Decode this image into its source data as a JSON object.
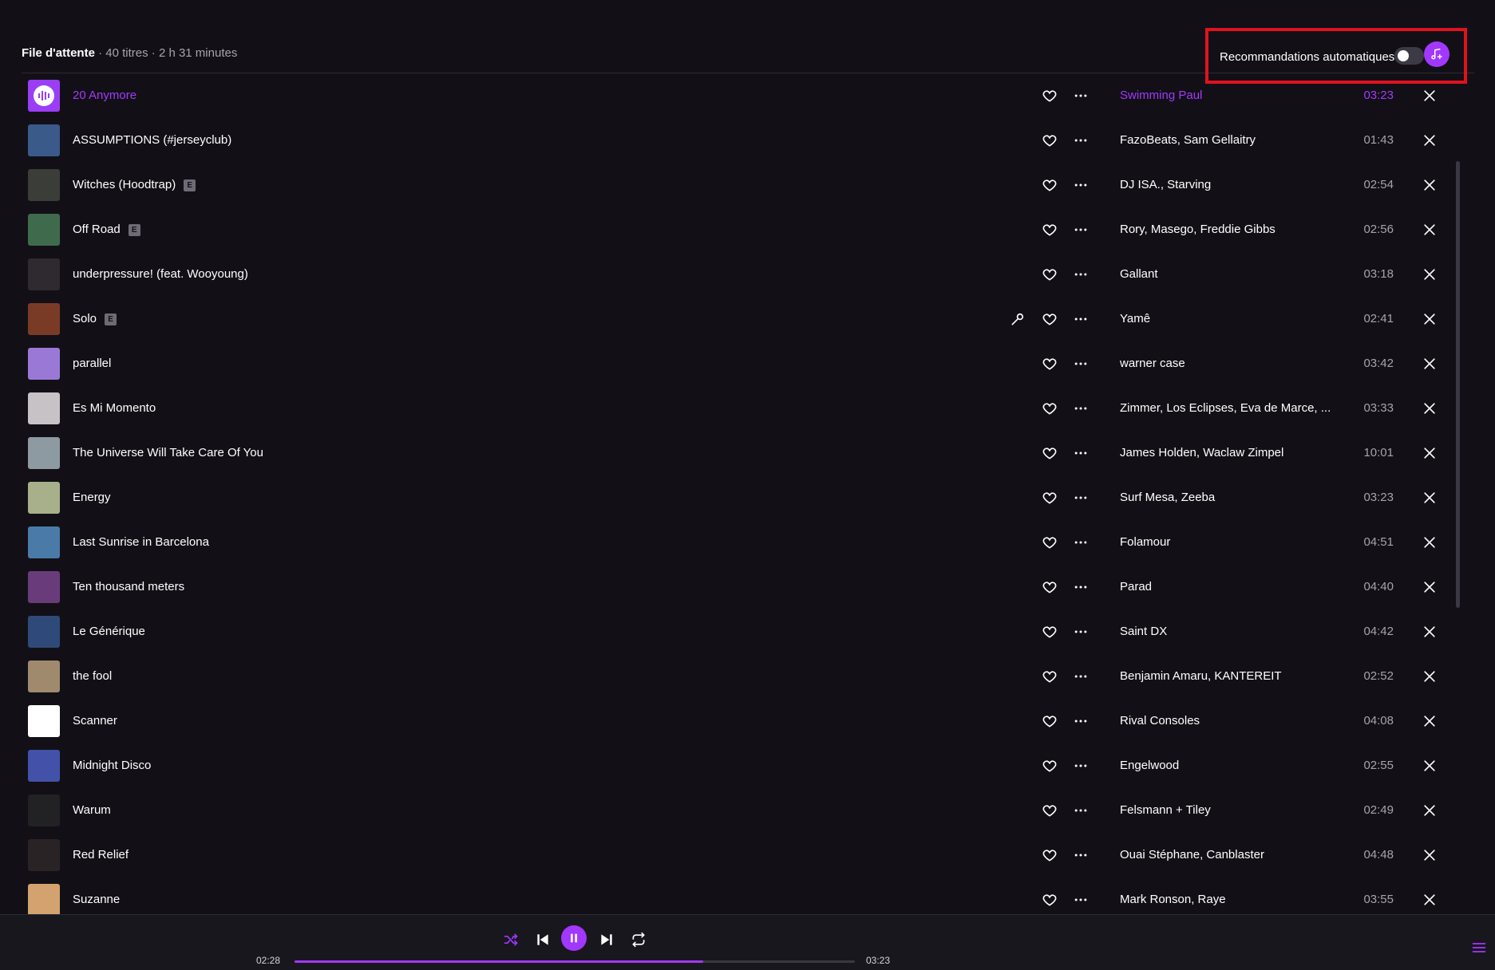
{
  "header": {
    "title": "File d'attente",
    "meta": " · 40 titres · 2 h 31 minutes"
  },
  "autorec": {
    "label": "Recommandations automatiques",
    "enabled": false
  },
  "badge_label": "E",
  "tracks": [
    {
      "title": "20 Anymore",
      "artist": "Swimming Paul",
      "duration": "03:23",
      "explicit": false,
      "current": true,
      "art": "#9b3df5"
    },
    {
      "title": "ASSUMPTIONS (#jerseyclub)",
      "artist": "FazoBeats, Sam Gellaitry",
      "duration": "01:43",
      "explicit": false,
      "art": "#3a5a8a"
    },
    {
      "title": "Witches (Hoodtrap)",
      "artist": "DJ ISA., Starving",
      "duration": "02:54",
      "explicit": true,
      "art": "#3b3d38"
    },
    {
      "title": "Off Road",
      "artist": "Rory, Masego, Freddie Gibbs",
      "duration": "02:56",
      "explicit": true,
      "art": "#3f6b4c"
    },
    {
      "title": "underpressure! (feat. Wooyoung)",
      "artist": "Gallant",
      "duration": "03:18",
      "explicit": false,
      "art": "#2e2a30"
    },
    {
      "title": "Solo",
      "artist": "Yamê",
      "duration": "02:41",
      "explicit": true,
      "lyrics": true,
      "art": "#7a3b26"
    },
    {
      "title": "parallel",
      "artist": "warner case",
      "duration": "03:42",
      "explicit": false,
      "art": "#9a79d6"
    },
    {
      "title": "Es Mi Momento",
      "artist": "Zimmer, Los Eclipses, Eva de Marce, ...",
      "duration": "03:33",
      "explicit": false,
      "art": "#c7c2c6"
    },
    {
      "title": "The Universe Will Take Care Of You",
      "artist": "James Holden, Waclaw Zimpel",
      "duration": "10:01",
      "explicit": false,
      "art": "#8e9aa2"
    },
    {
      "title": "Energy",
      "artist": "Surf Mesa, Zeeba",
      "duration": "03:23",
      "explicit": false,
      "art": "#a7b08a"
    },
    {
      "title": "Last Sunrise in Barcelona",
      "artist": "Folamour",
      "duration": "04:51",
      "explicit": false,
      "art": "#4a7ba8"
    },
    {
      "title": "Ten thousand meters",
      "artist": "Parad",
      "duration": "04:40",
      "explicit": false,
      "art": "#6a3b7a"
    },
    {
      "title": "Le Générique",
      "artist": "Saint DX",
      "duration": "04:42",
      "explicit": false,
      "art": "#2f4a78"
    },
    {
      "title": "the fool",
      "artist": "Benjamin Amaru, KANTEREIT",
      "duration": "02:52",
      "explicit": false,
      "art": "#a08a6e"
    },
    {
      "title": "Scanner",
      "artist": "Rival Consoles",
      "duration": "04:08",
      "explicit": false,
      "art": "#ffffff"
    },
    {
      "title": "Midnight Disco",
      "artist": "Engelwood",
      "duration": "02:55",
      "explicit": false,
      "art": "#4352a8"
    },
    {
      "title": "Warum",
      "artist": "Felsmann + Tiley",
      "duration": "02:49",
      "explicit": false,
      "art": "#222225"
    },
    {
      "title": "Red Relief",
      "artist": "Ouai Stéphane, Canblaster",
      "duration": "04:48",
      "explicit": false,
      "art": "#2a2326"
    },
    {
      "title": "Suzanne",
      "artist": "Mark Ronson, Raye",
      "duration": "03:55",
      "explicit": false,
      "art": "#d2a36e"
    }
  ],
  "player": {
    "elapsed": "02:28",
    "total": "03:23",
    "progress": 0.729
  },
  "colors": {
    "accent": "#a238ff",
    "highlight_box": "#e0121f",
    "background": "#121016"
  },
  "icons": {
    "add_music": "music-plus-icon",
    "heart": "heart-icon",
    "more": "more-icon",
    "lyrics": "microphone-icon",
    "remove": "close-icon",
    "shuffle": "shuffle-icon",
    "previous": "skip-previous-icon",
    "pause": "pause-icon",
    "next": "skip-next-icon",
    "repeat": "repeat-icon",
    "queue": "queue-list-icon"
  }
}
